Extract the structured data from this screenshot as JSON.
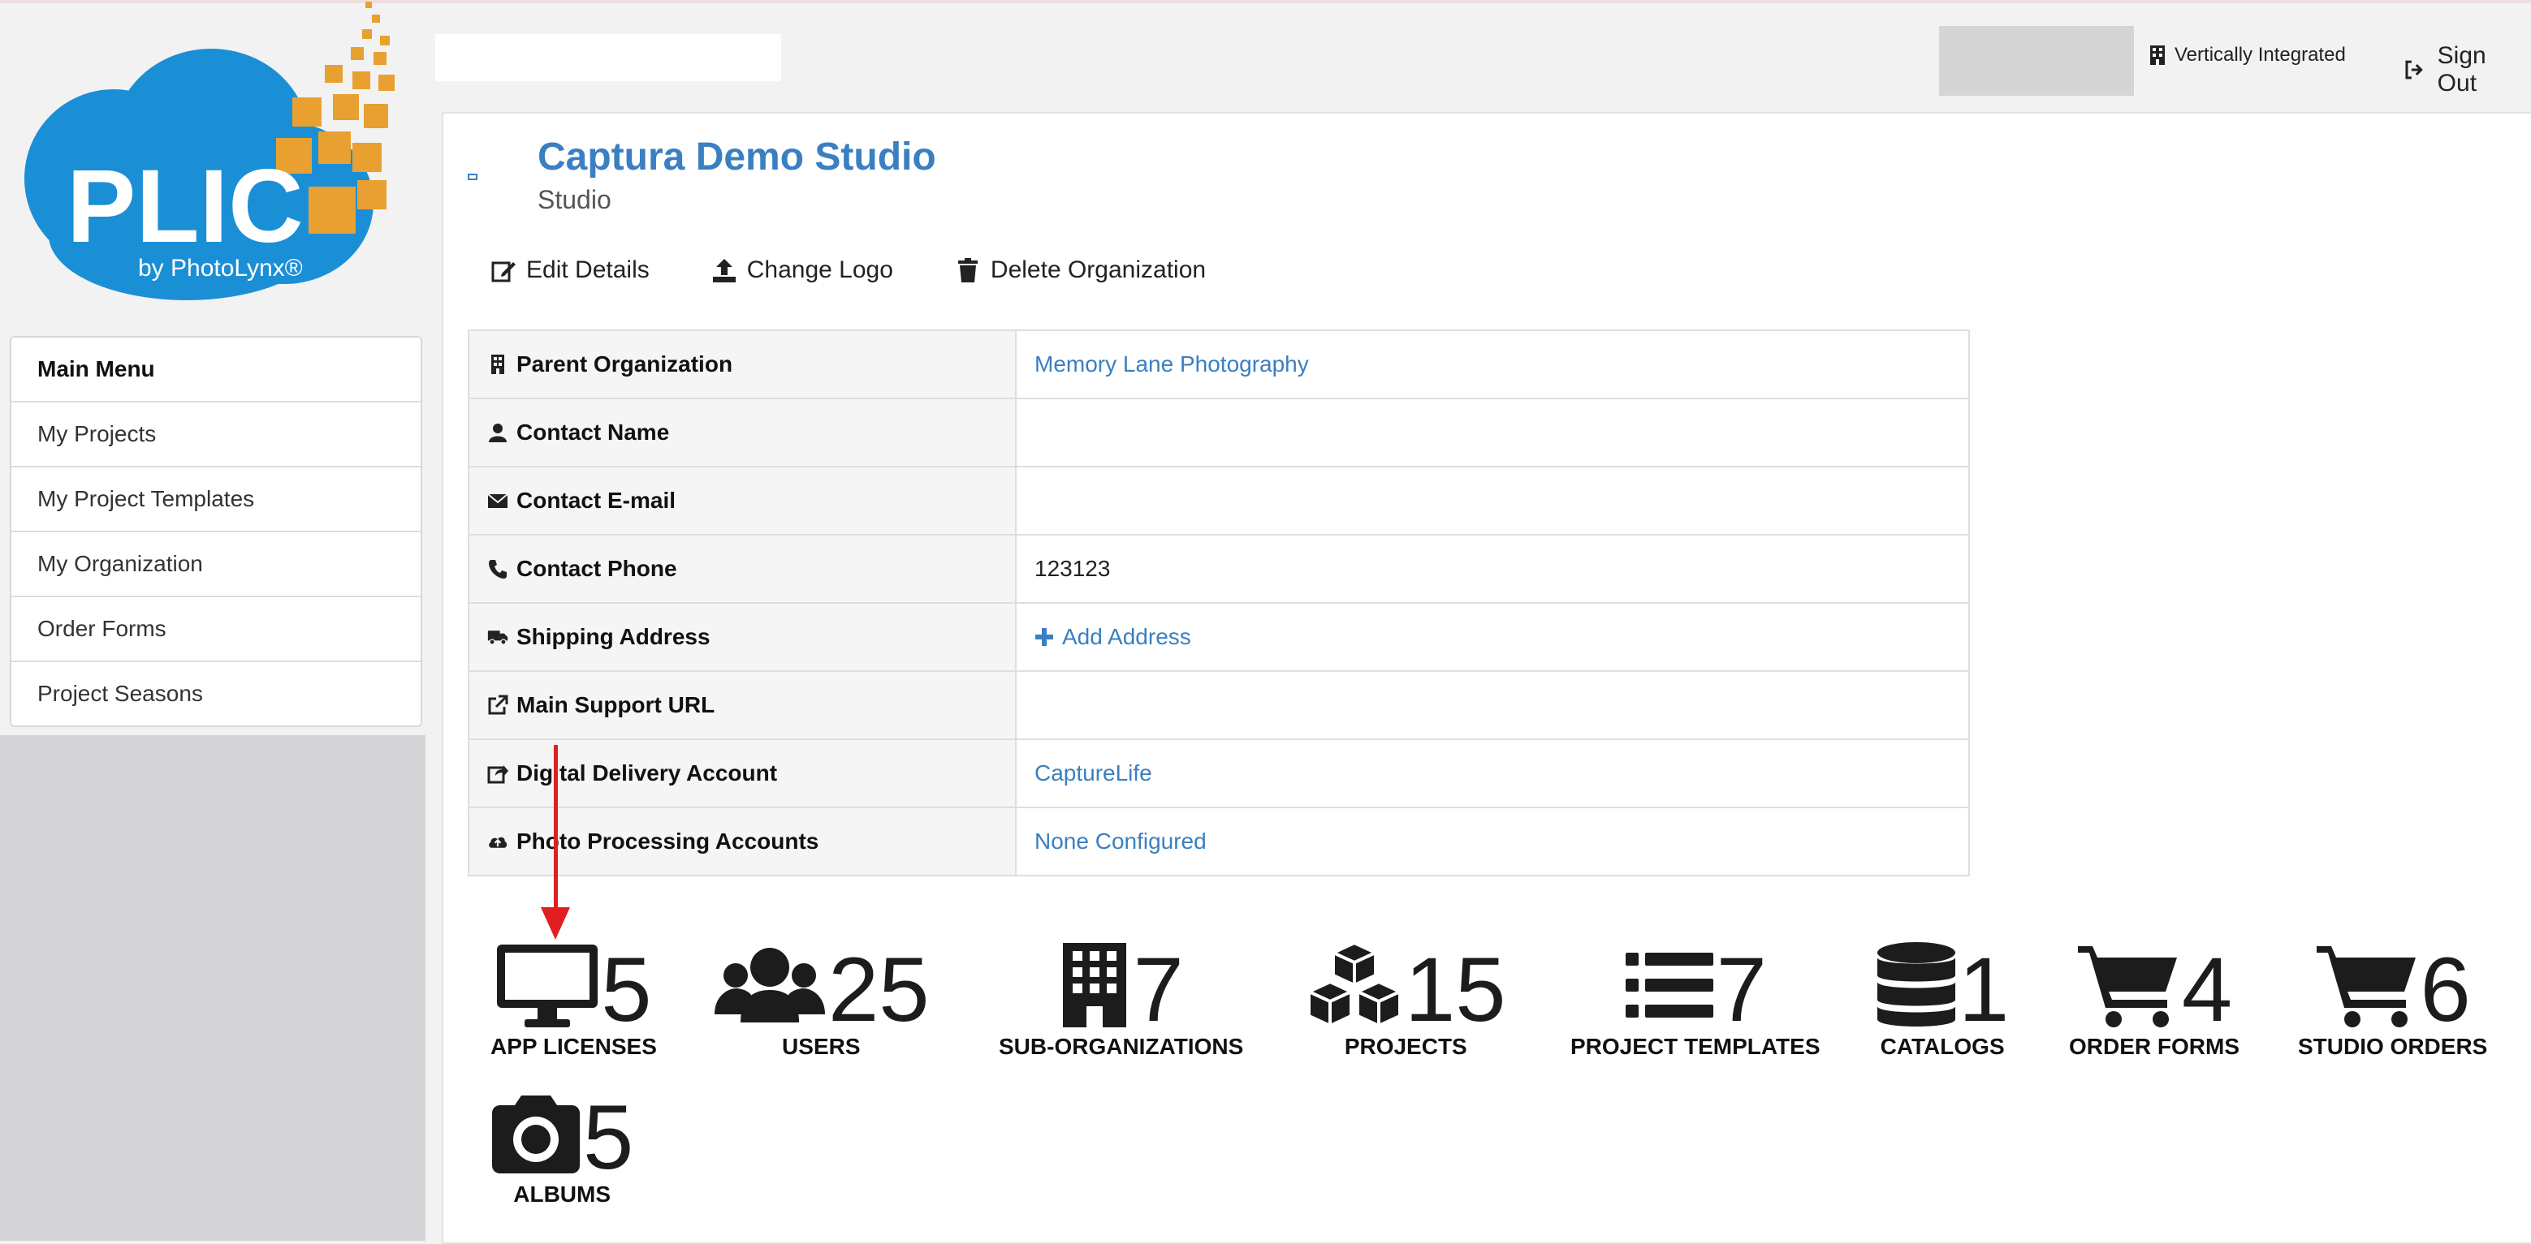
{
  "logo": {
    "main_text": "PLIC",
    "sub_text": "by PhotoLynx®"
  },
  "header": {
    "org_label": "Vertically Integrated",
    "sign_out_label": "Sign Out"
  },
  "sidebar": {
    "items": [
      {
        "label": "Main Menu"
      },
      {
        "label": "My Projects"
      },
      {
        "label": "My Project Templates"
      },
      {
        "label": "My Organization"
      },
      {
        "label": "Order Forms"
      },
      {
        "label": "Project Seasons"
      }
    ]
  },
  "organization": {
    "name": "Captura Demo Studio",
    "type": "Studio"
  },
  "actions": {
    "edit_label": "Edit Details",
    "logo_label": "Change Logo",
    "delete_label": "Delete Organization"
  },
  "details": [
    {
      "label": "Parent Organization",
      "value": "Memory Lane Photography",
      "icon": "building-icon"
    },
    {
      "label": "Contact Name",
      "value": "",
      "icon": "user-icon"
    },
    {
      "label": "Contact E-mail",
      "value": "",
      "icon": "envelope-icon"
    },
    {
      "label": "Contact Phone",
      "value": "123123",
      "icon": "phone-icon"
    },
    {
      "label": "Shipping Address",
      "value": "Add Address",
      "icon": "truck-icon"
    },
    {
      "label": "Main Support URL",
      "value": "",
      "icon": "external-link-icon"
    },
    {
      "label": "Digital Delivery Account",
      "value": "CaptureLife",
      "icon": "share-icon"
    },
    {
      "label": "Photo Processing Accounts",
      "value": "None Configured",
      "icon": "cloud-upload-icon"
    }
  ],
  "stats": [
    {
      "count": "5",
      "label": "APP LICENSES",
      "icon": "desktop-icon"
    },
    {
      "count": "25",
      "label": "USERS",
      "icon": "users-icon"
    },
    {
      "count": "7",
      "label": "SUB-ORGANIZATIONS",
      "icon": "building-icon"
    },
    {
      "count": "15",
      "label": "PROJECTS",
      "icon": "cubes-icon"
    },
    {
      "count": "7",
      "label": "PROJECT TEMPLATES",
      "icon": "list-icon"
    },
    {
      "count": "1",
      "label": "CATALOGS",
      "icon": "database-icon"
    },
    {
      "count": "4",
      "label": "ORDER FORMS",
      "icon": "cart-icon"
    },
    {
      "count": "6",
      "label": "STUDIO ORDERS",
      "icon": "cart-icon"
    },
    {
      "count": "5",
      "label": "ALBUMS",
      "icon": "camera-icon"
    }
  ],
  "colors": {
    "accent": "#3a7fc1",
    "logo_blue": "#1b8fd6",
    "logo_orange": "#e8a030",
    "arrow_red": "#e02020"
  }
}
